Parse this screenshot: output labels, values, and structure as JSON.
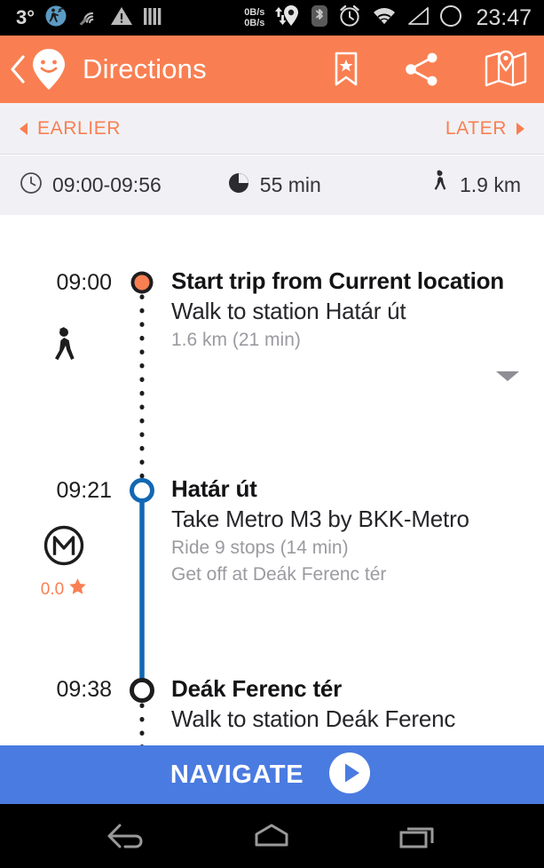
{
  "status_bar": {
    "temperature": "3°",
    "icons_left": [
      "activity-tracker-icon",
      "signal-waves-icon",
      "warning-triangle-icon",
      "vertical-bars-icon"
    ],
    "data_rate_up": "0B/s",
    "data_rate_down": "0B/s",
    "icons_right": [
      "location-pin-icon",
      "bluetooth-icon",
      "alarm-clock-icon",
      "wifi-icon",
      "signal-triangle-icon",
      "no-sim-circle-icon"
    ],
    "clock": "23:47"
  },
  "app_bar": {
    "title": "Directions",
    "back_icon": "back-chevron-icon",
    "logo_icon": "smiling-map-pin-icon",
    "bookmark_icon": "bookmark-star-icon",
    "share_icon": "share-icon",
    "map_icon": "map-pin-icon",
    "background": "#F97F52"
  },
  "time_nav": {
    "earlier_label": "EARLIER",
    "later_label": "LATER"
  },
  "summary": {
    "time_range": "09:00-09:56",
    "time_icon": "clock-icon",
    "duration": "55 min",
    "duration_icon": "pie-duration-icon",
    "distance": "1.9 km",
    "distance_icon": "walking-person-icon"
  },
  "itinerary": {
    "steps": [
      {
        "time": "09:00",
        "mode_icon": "walking-person-icon",
        "marker": "origin-dot",
        "title": "Start trip from Current location",
        "subtitle": "Walk to station Határ út",
        "meta": [
          "1.6 km (21  min)"
        ],
        "expandable": true
      },
      {
        "time": "09:21",
        "mode_icon": "metro-m-icon",
        "rating": "0.0",
        "rating_icon": "star-icon",
        "marker": "transfer-ring-blue",
        "title": "Határ út",
        "subtitle": "Take Metro M3 by BKK-Metro",
        "meta": [
          "Ride 9 stops (14  min)",
          "Get off at Deák Ferenc tér"
        ],
        "expandable": false
      },
      {
        "time": "09:38",
        "marker": "transfer-ring-dark",
        "title": "Deák Ferenc tér",
        "subtitle": "Walk to station Deák Ferenc",
        "meta": [],
        "expandable": false
      }
    ]
  },
  "navigate": {
    "label": "NAVIGATE",
    "play_icon": "play-icon",
    "background": "#4A7BE0"
  },
  "system_nav": {
    "back_icon": "android-back-icon",
    "home_icon": "android-home-icon",
    "recents_icon": "android-recents-icon"
  },
  "colors": {
    "accent_orange": "#F97F52",
    "accent_blue": "#4A7BE0",
    "bar_gray": "#F1F1F5"
  }
}
